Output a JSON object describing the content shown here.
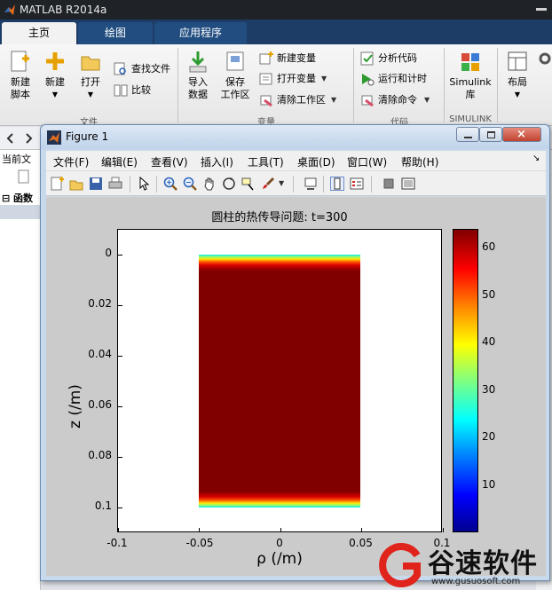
{
  "app": {
    "title": "MATLAB R2014a"
  },
  "ribbon_tabs": [
    {
      "label": "主页",
      "active": true
    },
    {
      "label": "绘图",
      "active": false
    },
    {
      "label": "应用程序",
      "active": false
    }
  ],
  "ribbon": {
    "new_script": "新建\n脚本",
    "new": "新建",
    "open": "打开",
    "find_files": "查找文件",
    "compare": "比较",
    "import_data": "导入\n数据",
    "save_workspace": "保存\n工作区",
    "new_variable": "新建变量",
    "open_variable": "打开变量",
    "clear_workspace": "清除工作区",
    "analyze_code": "分析代码",
    "run_and_time": "运行和计时",
    "clear_commands": "清除命令",
    "simulink": "Simulink\n库",
    "layout": "布局",
    "group_file": "文件",
    "group_variable": "变量",
    "group_code": "代码",
    "group_simulink": "SIMULINK"
  },
  "left_panel": {
    "current_folder": "当前文",
    "functions": "函数"
  },
  "figure": {
    "title": "Figure 1",
    "menu": [
      "文件(F)",
      "编辑(E)",
      "查看(V)",
      "插入(I)",
      "工具(T)",
      "桌面(D)",
      "窗口(W)",
      "帮助(H)"
    ]
  },
  "chart_data": {
    "type": "heatmap",
    "title": "圆柱的热传导问题: t=300",
    "xlabel": "ρ (/m)",
    "ylabel": "z (/m)",
    "xlim": [
      -0.1,
      0.1
    ],
    "ylim": [
      0.1,
      0
    ],
    "x_ticks": [
      "-0.1",
      "-0.05",
      "0",
      "0.05",
      "0.1"
    ],
    "y_ticks": [
      "0",
      "0.02",
      "0.04",
      "0.06",
      "0.08",
      "0.1"
    ],
    "field_extent": {
      "rho": [
        -0.05,
        0.05
      ],
      "z": [
        0,
        0.1
      ]
    },
    "interior_value": 64,
    "boundary_value": 0,
    "colorbar": {
      "min": 0,
      "max": 64,
      "ticks": [
        "10",
        "20",
        "30",
        "40",
        "50",
        "60"
      ],
      "colormap": "jet"
    },
    "colors": {
      "hot": "#800000",
      "cold": "#00008f"
    }
  },
  "watermark": {
    "name": "谷速软件",
    "url": "www.gusuosoft.com"
  }
}
